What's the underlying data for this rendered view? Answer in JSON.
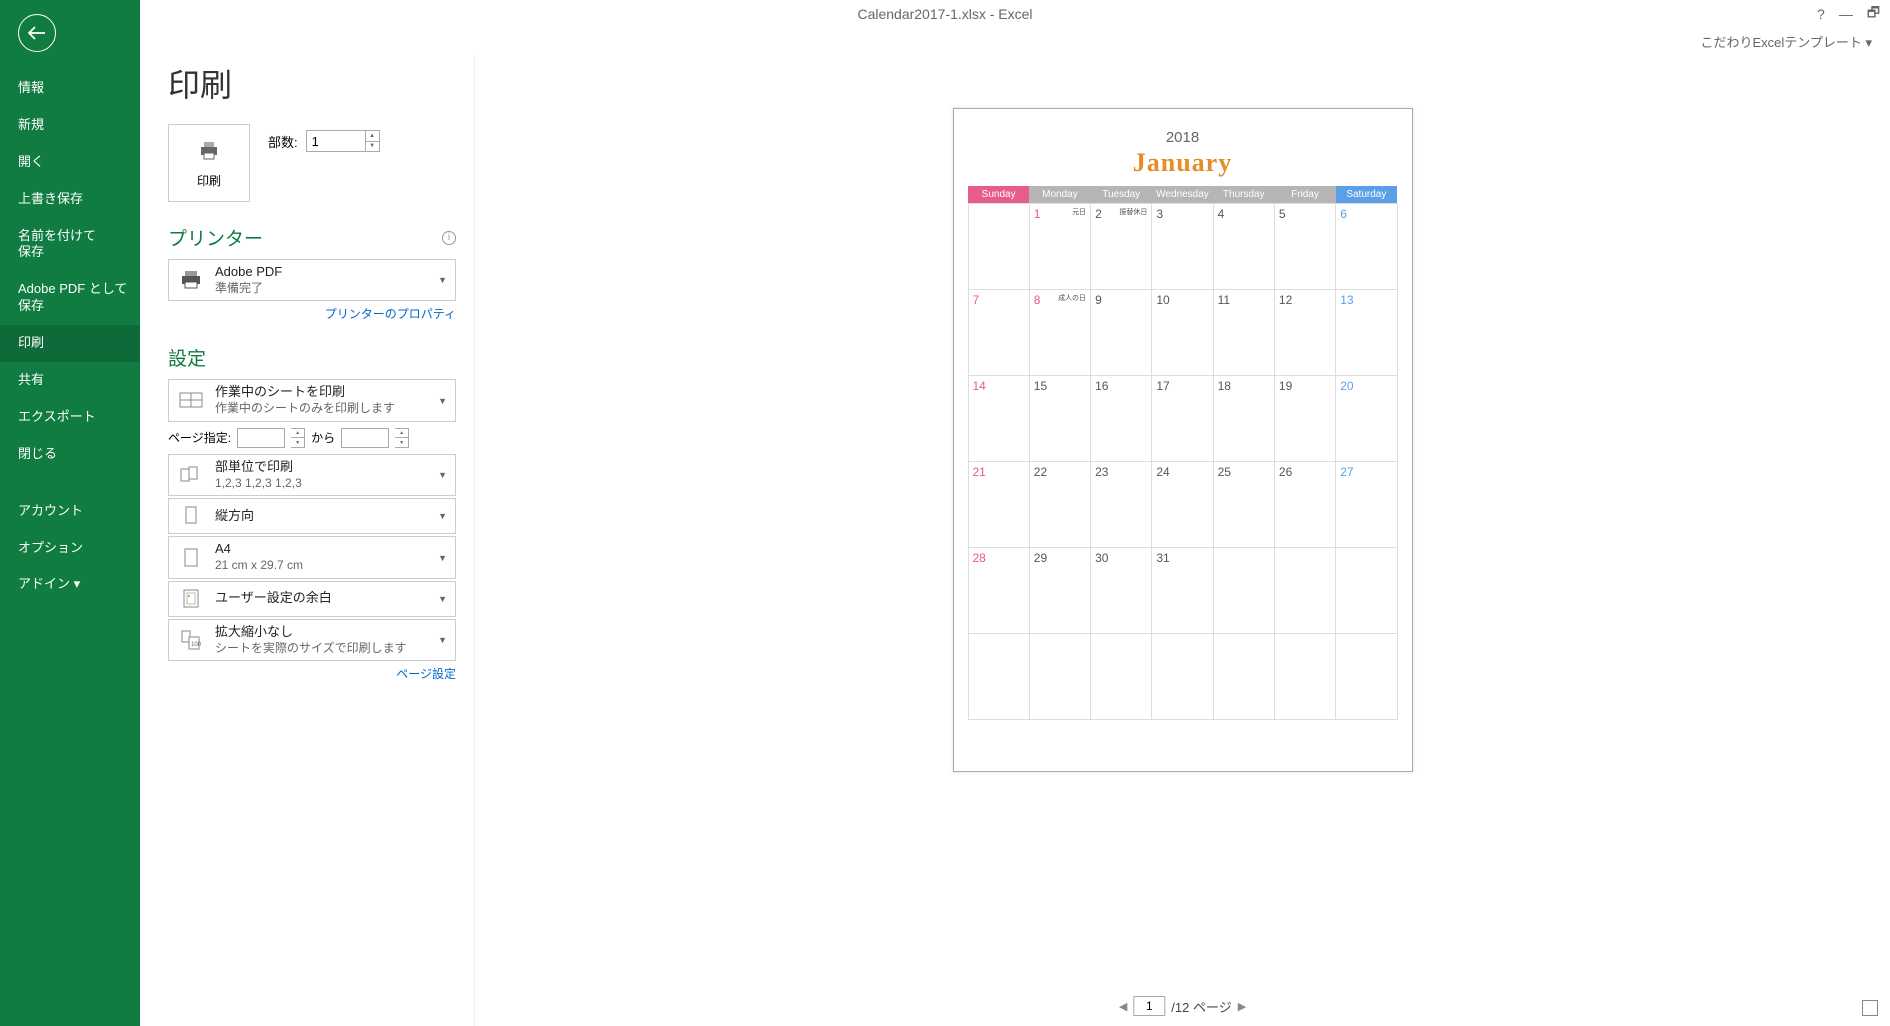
{
  "titlebar": {
    "title": "Calendar2017-1.xlsx - Excel",
    "help": "?",
    "min": "—",
    "max": "🗗"
  },
  "subbar": {
    "template_label": "こだわりExcelテンプレート",
    "chev": "▾"
  },
  "sidebar": {
    "items": [
      {
        "label": "情報"
      },
      {
        "label": "新規"
      },
      {
        "label": "開く"
      },
      {
        "label": "上書き保存"
      },
      {
        "label": "名前を付けて\n保存"
      },
      {
        "label": "Adobe PDF として\n保存"
      },
      {
        "label": "印刷",
        "active": true
      },
      {
        "label": "共有"
      },
      {
        "label": "エクスポート"
      },
      {
        "label": "閉じる"
      },
      {
        "gap": true
      },
      {
        "label": "アカウント"
      },
      {
        "label": "オプション"
      },
      {
        "label": "アドイン ▾"
      }
    ]
  },
  "print": {
    "heading": "印刷",
    "button_label": "印刷",
    "copies_label": "部数:",
    "copies_value": "1"
  },
  "printer": {
    "heading": "プリンター",
    "name": "Adobe PDF",
    "status": "準備完了",
    "props_link": "プリンターのプロパティ"
  },
  "settings": {
    "heading": "設定",
    "scope": {
      "t1": "作業中のシートを印刷",
      "t2": "作業中のシートのみを印刷します"
    },
    "page_range": {
      "label": "ページ指定:",
      "to": "から"
    },
    "collate": {
      "t1": "部単位で印刷",
      "t2": "1,2,3   1,2,3   1,2,3"
    },
    "orient": {
      "t1": "縦方向"
    },
    "paper": {
      "t1": "A4",
      "t2": "21 cm x 29.7 cm"
    },
    "margins": {
      "t1": "ユーザー設定の余白"
    },
    "scaling": {
      "t1": "拡大縮小なし",
      "t2": "シートを実際のサイズで印刷します",
      "badge": "100"
    },
    "page_setup_link": "ページ設定"
  },
  "pager": {
    "current": "1",
    "total_label": "/12 ページ"
  },
  "calendar": {
    "year": "2018",
    "month": "January",
    "dow": [
      "Sunday",
      "Monday",
      "Tuesday",
      "Wednesday",
      "Thursday",
      "Friday",
      "Saturday"
    ],
    "weeks": [
      [
        {
          "d": ""
        },
        {
          "d": "1",
          "hol": true,
          "note": "元日"
        },
        {
          "d": "2",
          "note": "振替休日"
        },
        {
          "d": "3"
        },
        {
          "d": "4"
        },
        {
          "d": "5"
        },
        {
          "d": "6"
        }
      ],
      [
        {
          "d": "7"
        },
        {
          "d": "8",
          "hol": true,
          "note": "成人の日"
        },
        {
          "d": "9"
        },
        {
          "d": "10"
        },
        {
          "d": "11"
        },
        {
          "d": "12"
        },
        {
          "d": "13"
        }
      ],
      [
        {
          "d": "14"
        },
        {
          "d": "15"
        },
        {
          "d": "16"
        },
        {
          "d": "17"
        },
        {
          "d": "18"
        },
        {
          "d": "19"
        },
        {
          "d": "20"
        }
      ],
      [
        {
          "d": "21"
        },
        {
          "d": "22"
        },
        {
          "d": "23"
        },
        {
          "d": "24"
        },
        {
          "d": "25"
        },
        {
          "d": "26"
        },
        {
          "d": "27"
        }
      ],
      [
        {
          "d": "28"
        },
        {
          "d": "29"
        },
        {
          "d": "30"
        },
        {
          "d": "31"
        },
        {
          "d": ""
        },
        {
          "d": ""
        },
        {
          "d": ""
        }
      ],
      [
        {
          "d": ""
        },
        {
          "d": ""
        },
        {
          "d": ""
        },
        {
          "d": ""
        },
        {
          "d": ""
        },
        {
          "d": ""
        },
        {
          "d": ""
        }
      ]
    ]
  }
}
